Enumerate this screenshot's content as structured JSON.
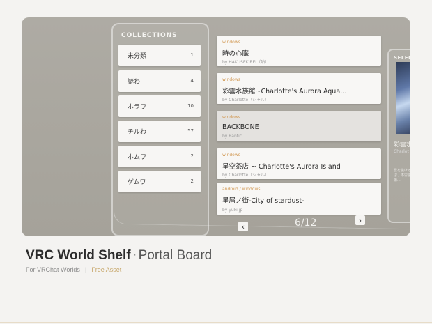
{
  "collections": {
    "title": "COLLECTIONS",
    "items": [
      {
        "name": "未分類",
        "count": "1"
      },
      {
        "name": "謎わ",
        "count": "4"
      },
      {
        "name": "ホラワ",
        "count": "10"
      },
      {
        "name": "チルわ",
        "count": "57"
      },
      {
        "name": "ホムワ",
        "count": "2"
      },
      {
        "name": "ゲムワ",
        "count": "2"
      }
    ]
  },
  "worlds": [
    {
      "platform": "windows",
      "title": "時の心臓",
      "author": "by HAKUSEKIREI（珀）"
    },
    {
      "platform": "windows",
      "title": "彩雲水族館~Charlotte's Aurora Aqua…",
      "author": "by Charlotte（シャル）"
    },
    {
      "platform": "windows",
      "title": "BACKBONE",
      "author": "by Rantic"
    },
    {
      "platform": "windows",
      "title": "星空茶店 ~ Charlotte's Aurora Island",
      "author": "by Charlotte（シャル）"
    },
    {
      "platform": "android / windows",
      "title": "星屑ノ街-City of stardust-",
      "author": "by yuki-jp"
    }
  ],
  "pager": {
    "prev": "‹",
    "next": "›",
    "indicator": "6/12"
  },
  "selected": {
    "title": "SELECTE",
    "name": "彩雲水",
    "author": "Charlot",
    "desc": "雲を抜ける水族館。ぷ、不思議なリーズ第..."
  },
  "product": {
    "title": "VRC World Shelf",
    "separator": "·",
    "subtitle": "Portal Board",
    "for": "For VRChat Worlds",
    "divider": "|",
    "tag": "Free Asset"
  },
  "colors": {
    "accent": "#d29a55",
    "tag": "#c7a76a",
    "background": "#f4f3f1"
  }
}
